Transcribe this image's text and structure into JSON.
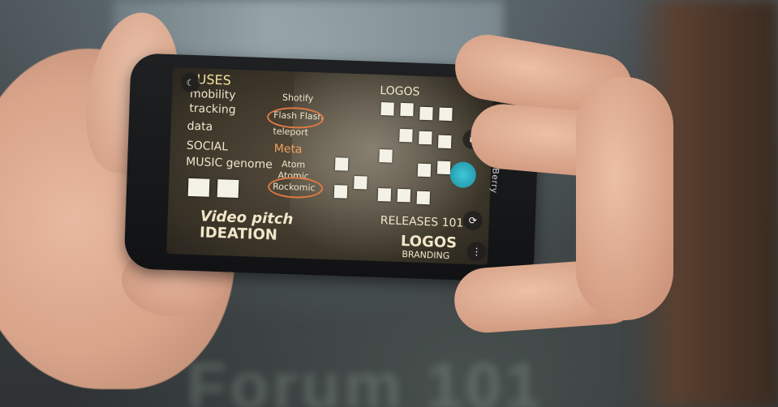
{
  "scene": {
    "bg_text": "Forum 101"
  },
  "phone": {
    "brand": "BlackBerry",
    "screen_notes": [
      "USES",
      "mobility",
      "tracking",
      "data",
      "SOCIAL",
      "MUSIC genome",
      "Shotify",
      "Flash Flash",
      "teleport",
      "Meta",
      "Atom",
      "Atomic",
      "Rockomic",
      "Video pitch",
      "IDEATION",
      "LOGOS",
      "RELEASES 101",
      "LOGOS",
      "BRANDING"
    ],
    "icons": {
      "video": "video-camera-icon",
      "shutter": "shutter-icon",
      "switch": "switch-camera-icon",
      "menu": "more-menu-icon",
      "top_left": "settings-icon"
    }
  }
}
